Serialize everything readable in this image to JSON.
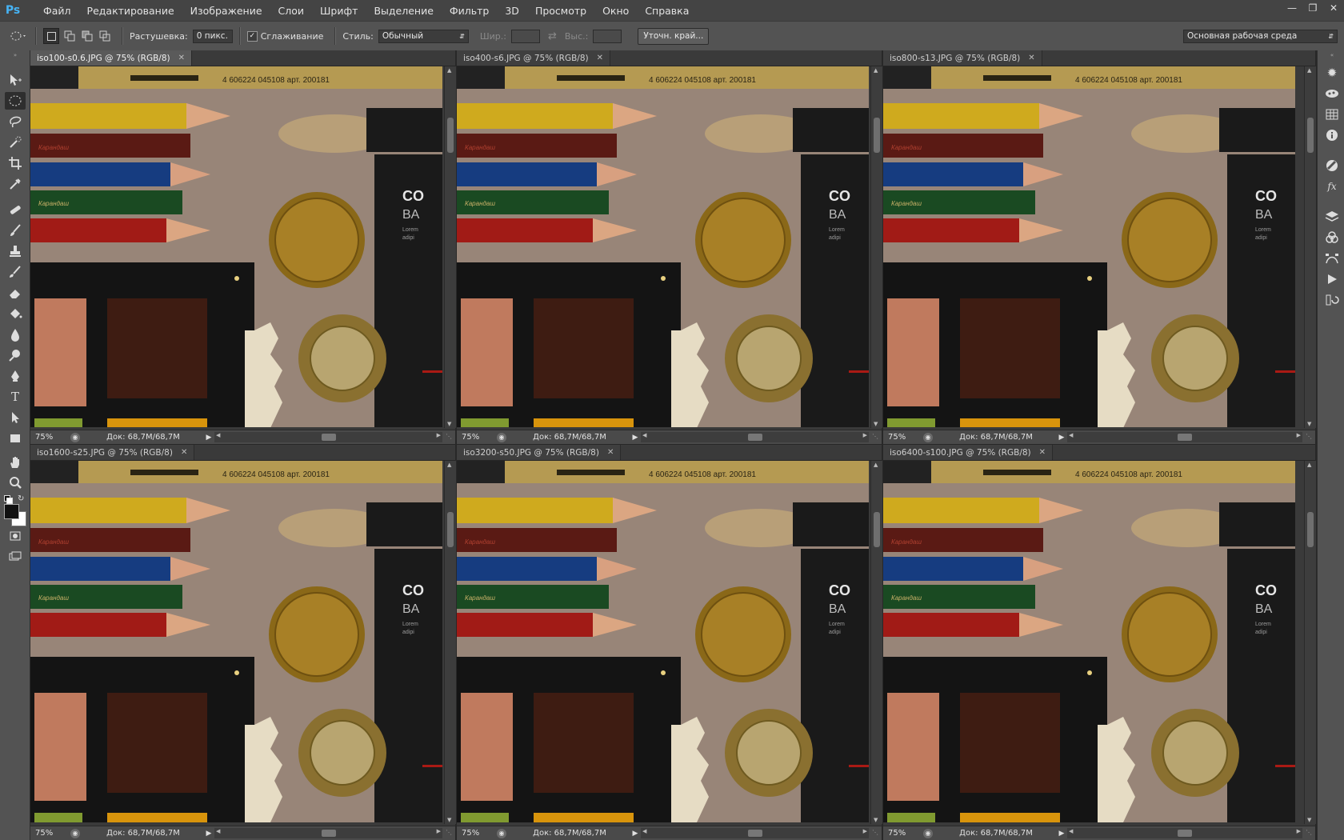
{
  "app": {
    "logo": "Ps"
  },
  "menu": [
    "Файл",
    "Редактирование",
    "Изображение",
    "Слои",
    "Шрифт",
    "Выделение",
    "Фильтр",
    "3D",
    "Просмотр",
    "Окно",
    "Справка"
  ],
  "options": {
    "feather_label": "Растушевка:",
    "feather_value": "0 пикс.",
    "antialias_label": "Сглаживание",
    "antialias_checked": true,
    "style_label": "Стиль:",
    "style_value": "Обычный",
    "width_label": "Шир.:",
    "height_label": "Выс.:",
    "refine_button": "Уточн. край...",
    "workspace": "Основная рабочая среда"
  },
  "colors": {
    "accent": "#46b3f5",
    "foreground": "#111111",
    "background": "#ffffff"
  },
  "documents": [
    {
      "tab": "iso100-s0.6.JPG @ 75% (RGB/8)",
      "zoom": "75%",
      "doc_info": "Док: 68,7M/68,7M",
      "active": true
    },
    {
      "tab": "iso400-s6.JPG @ 75% (RGB/8)",
      "zoom": "75%",
      "doc_info": "Док: 68,7M/68,7M",
      "active": false
    },
    {
      "tab": "iso800-s13.JPG @ 75% (RGB/8)",
      "zoom": "75%",
      "doc_info": "Док: 68,7M/68,7M",
      "active": false
    },
    {
      "tab": "iso1600-s25.JPG @ 75% (RGB/8)",
      "zoom": "75%",
      "doc_info": "Док: 68,7M/68,7M",
      "active": false
    },
    {
      "tab": "iso3200-s50.JPG @ 75% (RGB/8)",
      "zoom": "75%",
      "doc_info": "Док: 68,7M/68,7M",
      "active": false
    },
    {
      "tab": "iso6400-s100.JPG @ 75% (RGB/8)",
      "zoom": "75%",
      "doc_info": "Док: 68,7M/68,7M",
      "active": false
    }
  ],
  "photo": {
    "barcode_text": "4 606224 045108 арт. 200181",
    "pencil_text": "Карандаш",
    "box_text_1": "CO",
    "box_text_2": "BA",
    "box_small_1": "Lorem",
    "box_small_2": "adipi"
  },
  "tools": [
    "move-tool",
    "elliptical-marquee-tool",
    "lasso-tool",
    "quick-selection-tool",
    "crop-tool",
    "eyedropper-tool",
    "healing-brush-tool",
    "brush-tool",
    "clone-stamp-tool",
    "history-brush-tool",
    "eraser-tool",
    "paint-bucket-tool",
    "blur-tool",
    "dodge-tool",
    "pen-tool",
    "type-tool",
    "path-selection-tool",
    "rectangle-tool",
    "hand-tool",
    "zoom-tool"
  ],
  "dock_icons": [
    "color-panel-icon",
    "adjustments-panel-icon",
    "swatches-panel-icon",
    "info-panel-icon",
    "styles-panel-icon",
    "fx-icon",
    "layers-panel-icon",
    "channels-panel-icon",
    "paths-panel-icon",
    "actions-panel-icon",
    "history-panel-icon"
  ]
}
